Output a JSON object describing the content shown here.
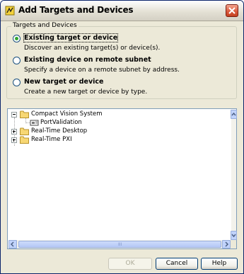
{
  "window": {
    "title": "Add Targets and Devices",
    "close_icon": "close-icon"
  },
  "targets_group": {
    "legend": "Targets and Devices",
    "options": [
      {
        "label": "Existing target or device",
        "description": "Discover an existing target(s) or device(s).",
        "selected": true
      },
      {
        "label": "Existing device on remote subnet",
        "description": "Specify a device on a remote subnet by address.",
        "selected": false
      },
      {
        "label": "New target or device",
        "description": "Create a new target or device by type.",
        "selected": false
      }
    ]
  },
  "tree": {
    "items": [
      {
        "label": "Compact Vision System",
        "expanded": true,
        "icon": "folder-icon"
      },
      {
        "label": "PortValidation",
        "icon": "device-icon"
      },
      {
        "label": "Real-Time Desktop",
        "expanded": false,
        "icon": "folder-icon"
      },
      {
        "label": "Real-Time PXI",
        "expanded": false,
        "icon": "folder-icon"
      }
    ],
    "hscroll_grip": "III"
  },
  "buttons": {
    "ok": "OK",
    "cancel": "Cancel",
    "help": "Help"
  },
  "colors": {
    "dialog_bg": "#ece9d8",
    "radio_selected": "#31a530",
    "close_button": "#d9573a",
    "scrollbar": "#c1d3fb"
  }
}
